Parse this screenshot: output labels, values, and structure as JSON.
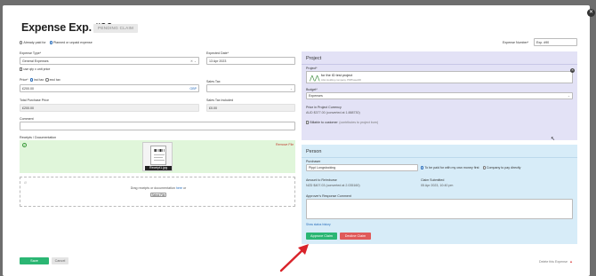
{
  "header": {
    "title": "Expense Exp. #90",
    "status_badge": "PENDING CLAIM"
  },
  "payment_mode": {
    "option_paid": "Already paid for",
    "option_planned": "Planned or unpaid expense",
    "selected": "planned"
  },
  "expense_number": {
    "label": "Expense Number*",
    "value": "Exp. #90"
  },
  "expense_type": {
    "label": "Expense Type*",
    "value": "General Expenses"
  },
  "use_qty": {
    "label": "use qty x unit price"
  },
  "expected_date": {
    "label": "Expected Date*",
    "value": "13 Apr 2023"
  },
  "price": {
    "label": "Price*",
    "opt_incl": "incl tax",
    "opt_excl": "excl tax",
    "value": "£200.00",
    "currency": "GBP"
  },
  "sales_tax": {
    "label": "Sales Tax",
    "value": ""
  },
  "total_purchase_price": {
    "label": "Total Purchase Price",
    "value": "£200.00"
  },
  "sales_tax_included": {
    "label": "Sales Tax Included",
    "value": "£0.00"
  },
  "comment": {
    "label": "Comment",
    "value": ""
  },
  "receipts": {
    "label": "Receipts / Documentation",
    "remove_file": "Remove File",
    "file_name": "Receipt1.jpg",
    "drop_text_prefix": "Drag receipts or documentation ",
    "drop_link": "here",
    "drop_text_suffix": " or",
    "select_file": "Select File"
  },
  "project": {
    "section_title": "Project",
    "label": "Project*",
    "name": "for the ID test project",
    "sub": "AGL Holding company, P0Phase2ID",
    "budget_label": "Budget*",
    "budget_value": "Expenses",
    "price_in_currency_label": "Price in Project Currency",
    "price_in_currency_value": "AUD $377.00 (converted at 1.888730)",
    "billable_label": "Billable to customer",
    "billable_note": "(contributes to project burn)"
  },
  "person": {
    "section_title": "Person",
    "purchaser_label": "Purchaser",
    "purchaser_value": "Pippi Longstocking",
    "paid_by_me": "To be paid for with my own money first",
    "paid_by_company": "Company to pay directly",
    "reimburse_label": "Amount to Reimburse",
    "reimburse_value": "NZD $407.03 (converted at 2.035160)",
    "claim_submitted_label": "Claim Submitted",
    "claim_submitted_value": "05 Apr 2023, 10:40 pm",
    "approver_comment_label": "Approver's Response Comment",
    "approver_comment_value": "",
    "show_status_history": "Show status history",
    "approve_button": "Approve Claim",
    "decline_button": "Decline Claim"
  },
  "footer": {
    "save": "Save",
    "cancel": "Cancel",
    "delete": "Delete this Expense"
  },
  "colors": {
    "accent_green": "#2bb673",
    "decline_red": "#e05a5a",
    "project_panel": "#e3e2f6",
    "person_panel": "#d7ecf8",
    "annotation_arrow": "#d9232a"
  }
}
